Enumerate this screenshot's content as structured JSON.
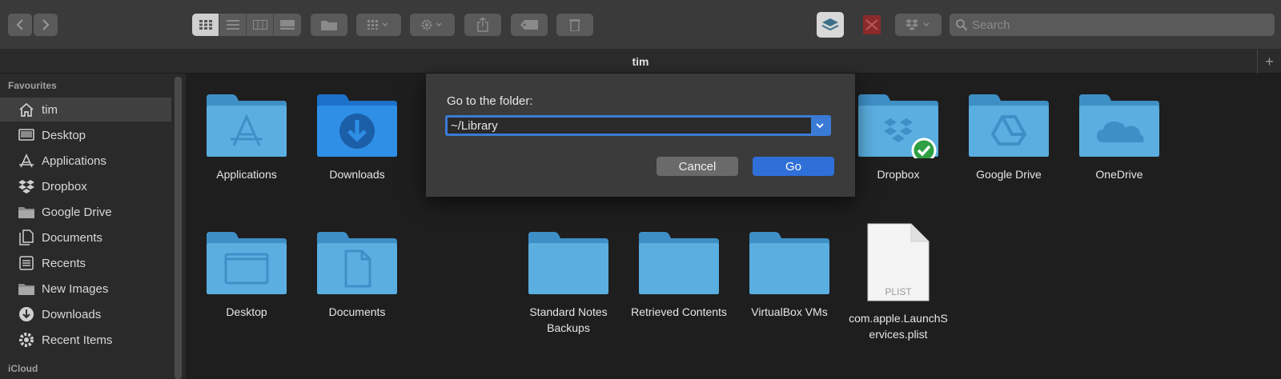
{
  "window": {
    "title": "tim"
  },
  "toolbar": {
    "search_placeholder": "Search"
  },
  "sidebar": {
    "sections": [
      {
        "heading": "Favourites"
      },
      {
        "heading": "iCloud"
      }
    ],
    "items": [
      {
        "label": "tim",
        "icon": "home-icon"
      },
      {
        "label": "Desktop",
        "icon": "desktop-icon"
      },
      {
        "label": "Applications",
        "icon": "applications-icon"
      },
      {
        "label": "Dropbox",
        "icon": "dropbox-icon"
      },
      {
        "label": "Google Drive",
        "icon": "folder-icon"
      },
      {
        "label": "Documents",
        "icon": "documents-icon"
      },
      {
        "label": "Recents",
        "icon": "recents-icon"
      },
      {
        "label": "New Images",
        "icon": "folder-icon"
      },
      {
        "label": "Downloads",
        "icon": "downloads-icon"
      },
      {
        "label": "Recent Items",
        "icon": "gear-icon"
      }
    ]
  },
  "content": {
    "items": [
      {
        "label": "Applications",
        "icon": "applications-folder-icon"
      },
      {
        "label": "Downloads",
        "icon": "downloads-folder-icon"
      },
      {
        "label": "Dropbox",
        "icon": "dropbox-folder-icon"
      },
      {
        "label": "Google Drive",
        "icon": "google-drive-folder-icon"
      },
      {
        "label": "OneDrive",
        "icon": "onedrive-folder-icon"
      },
      {
        "label": "Desktop",
        "icon": "desktop-folder-icon"
      },
      {
        "label": "Documents",
        "icon": "documents-folder-icon"
      },
      {
        "label": "Standard Notes Backups",
        "icon": "folder-icon"
      },
      {
        "label": "Retrieved Contents",
        "icon": "folder-icon"
      },
      {
        "label": "VirtualBox VMs",
        "icon": "folder-icon"
      },
      {
        "label": "com.apple.LaunchServices.plist",
        "icon": "plist-file-icon",
        "badge": "PLIST"
      }
    ]
  },
  "dialog": {
    "prompt": "Go to the folder:",
    "path_value": "~/Library",
    "cancel_label": "Cancel",
    "go_label": "Go"
  },
  "colors": {
    "accent": "#3a7bd5",
    "folder": "#5aaee0",
    "folder_dark": "#3f8fc7",
    "sync_ok": "#2ea043"
  }
}
